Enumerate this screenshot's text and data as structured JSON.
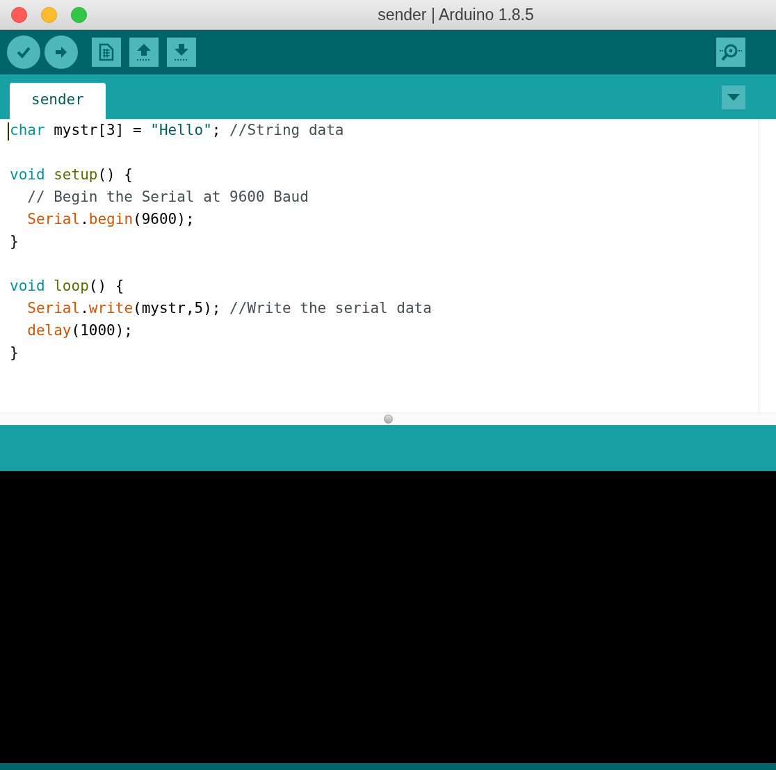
{
  "window": {
    "title": "sender | Arduino 1.8.5"
  },
  "toolbar": {
    "buttons": [
      {
        "kind": "verify"
      },
      {
        "kind": "upload"
      },
      {
        "kind": "new"
      },
      {
        "kind": "open"
      },
      {
        "kind": "save"
      }
    ],
    "serial_monitor": {
      "kind": "serial-monitor"
    }
  },
  "tabs": [
    {
      "label": "sender",
      "selected": true
    }
  ],
  "editor": {
    "lines": [
      {
        "kind": "code",
        "tokens": [
          {
            "text": "char",
            "kind": "keyword"
          },
          {
            "text": " mystr[3] = ",
            "kind": "plain"
          },
          {
            "text": "\"Hello\"",
            "kind": "string"
          },
          {
            "text": "; ",
            "kind": "plain"
          },
          {
            "text": "//String data",
            "kind": "comment"
          }
        ]
      },
      {
        "kind": "blank"
      },
      {
        "kind": "code",
        "tokens": [
          {
            "text": "void ",
            "kind": "keyword"
          },
          {
            "text": "setup",
            "kind": "function"
          },
          {
            "text": "() {",
            "kind": "plain"
          }
        ]
      },
      {
        "kind": "code",
        "tokens": [
          {
            "text": "  // Begin the Serial at 9600 Baud",
            "kind": "comment"
          }
        ]
      },
      {
        "kind": "code",
        "tokens": [
          {
            "text": "  Serial",
            "kind": "builtin"
          },
          {
            "text": ".",
            "kind": "plain"
          },
          {
            "text": "begin",
            "kind": "builtin"
          },
          {
            "text": "(9600);",
            "kind": "plain"
          }
        ]
      },
      {
        "kind": "code",
        "tokens": [
          {
            "text": "}",
            "kind": "plain"
          }
        ]
      },
      {
        "kind": "blank"
      },
      {
        "kind": "code",
        "tokens": [
          {
            "text": "void ",
            "kind": "keyword"
          },
          {
            "text": "loop",
            "kind": "function"
          },
          {
            "text": "() {",
            "kind": "plain"
          }
        ]
      },
      {
        "kind": "code",
        "tokens": [
          {
            "text": "  Serial",
            "kind": "builtin"
          },
          {
            "text": ".",
            "kind": "plain"
          },
          {
            "text": "write",
            "kind": "builtin"
          },
          {
            "text": "(mystr,5); ",
            "kind": "plain"
          },
          {
            "text": "//Write the serial data",
            "kind": "comment"
          }
        ]
      },
      {
        "kind": "code",
        "tokens": [
          {
            "text": "  delay",
            "kind": "builtin"
          },
          {
            "text": "(1000);",
            "kind": "plain"
          }
        ]
      },
      {
        "kind": "code",
        "tokens": [
          {
            "text": "}",
            "kind": "plain"
          }
        ]
      }
    ]
  }
}
